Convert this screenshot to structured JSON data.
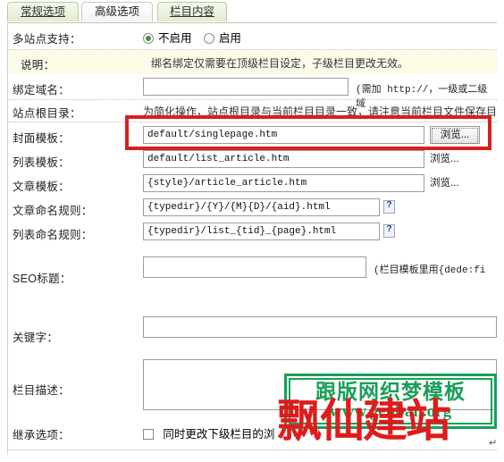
{
  "tabs": [
    {
      "label": "常规选项",
      "active": false
    },
    {
      "label": "高级选项",
      "active": true
    },
    {
      "label": "栏目内容",
      "active": false
    }
  ],
  "rows": {
    "multisite": {
      "label": "多站点支持：",
      "options": [
        {
          "label": "不启用",
          "selected": true
        },
        {
          "label": "启用",
          "selected": false
        }
      ]
    },
    "explain": {
      "label": "说明：",
      "text": "绑名绑定仅需要在顶级栏目设定，子级栏目更改无效。"
    },
    "bind_domain": {
      "label": "绑定域名：",
      "value": "",
      "hint": "(需加 http://，一级或二级域"
    },
    "site_root": {
      "label": "站点根目录：",
      "text": "为简化操作，站点根目录与当前栏目目录一致，请注意当前栏目文件保存目"
    },
    "cover_template": {
      "label": "封面模板：",
      "value": "default/singlepage.htm",
      "browse": "浏览..."
    },
    "list_template": {
      "label": "列表模板：",
      "value": "default/list_article.htm",
      "browse": "浏览..."
    },
    "article_template": {
      "label": "文章模板：",
      "value": "{style}/article_article.htm",
      "browse": "浏览..."
    },
    "article_naming": {
      "label": "文章命名规则：",
      "value": "{typedir}/{Y}/{M}{D}/{aid}.html",
      "help": "help-icon"
    },
    "list_naming": {
      "label": "列表命名规则：",
      "value": "{typedir}/list_{tid}_{page}.html",
      "help": "help-icon"
    },
    "seo_title": {
      "label": "SEO标题：",
      "value": "",
      "hint": "(栏目模板里用{dede:fi"
    },
    "keywords": {
      "label": "关键字：",
      "value": ""
    },
    "description": {
      "label": "栏目描述：",
      "value": ""
    },
    "inherit": {
      "label": "继承选项：",
      "checkbox_label": "同时更改下级栏目的浏",
      "checked": false
    }
  },
  "watermark": {
    "line1": "跟版网织梦模板",
    "line2": "www.genban.org",
    "overlay": "飘仙建站",
    "green": "#16a05a",
    "red": "#e01b1b"
  },
  "highlight": {
    "color": "#d81f1f",
    "target": "cover_template"
  },
  "caret": "↵"
}
